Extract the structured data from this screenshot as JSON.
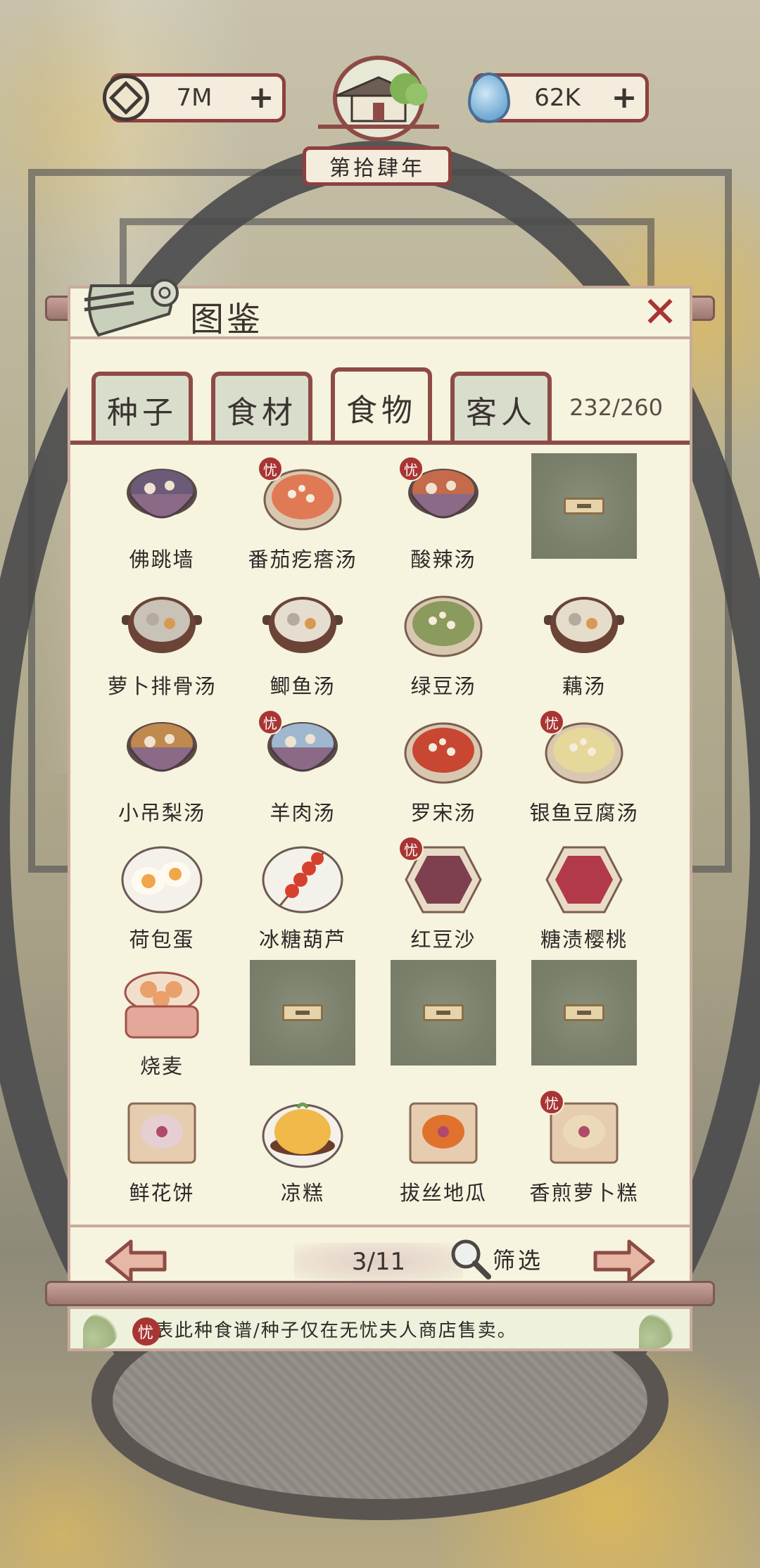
{
  "resources": {
    "coins": {
      "value": "7M",
      "icon": "coin-icon"
    },
    "water": {
      "value": "62K",
      "icon": "water-drop-icon"
    }
  },
  "year": "第拾肆年",
  "panel": {
    "title": "图鉴",
    "close_label": "✕",
    "tabs": [
      {
        "label": "种子",
        "active": false
      },
      {
        "label": "食材",
        "active": false
      },
      {
        "label": "食物",
        "active": true
      },
      {
        "label": "客人",
        "active": false
      }
    ],
    "count": "232/260"
  },
  "items": [
    {
      "name": "佛跳墙",
      "shop_only": false,
      "locked": false,
      "kind": "bowl",
      "color": "#6b5a78"
    },
    {
      "name": "番茄疙瘩汤",
      "shop_only": true,
      "locked": false,
      "kind": "plate",
      "color": "#e07a55"
    },
    {
      "name": "酸辣汤",
      "shop_only": true,
      "locked": false,
      "kind": "bowl",
      "color": "#c56a4a"
    },
    {
      "name": "",
      "shop_only": false,
      "locked": true
    },
    {
      "name": "萝卜排骨汤",
      "shop_only": false,
      "locked": false,
      "kind": "pot",
      "color": "#c9c2b6"
    },
    {
      "name": "鲫鱼汤",
      "shop_only": false,
      "locked": false,
      "kind": "pot",
      "color": "#e4ddd0"
    },
    {
      "name": "绿豆汤",
      "shop_only": false,
      "locked": false,
      "kind": "plate",
      "color": "#8b9a5d"
    },
    {
      "name": "藕汤",
      "shop_only": false,
      "locked": false,
      "kind": "pot",
      "color": "#e6dccb"
    },
    {
      "name": "小吊梨汤",
      "shop_only": false,
      "locked": false,
      "kind": "bowl",
      "color": "#c08a4e"
    },
    {
      "name": "羊肉汤",
      "shop_only": true,
      "locked": false,
      "kind": "bowl",
      "color": "#9fb8d0"
    },
    {
      "name": "罗宋汤",
      "shop_only": false,
      "locked": false,
      "kind": "plate",
      "color": "#c84732"
    },
    {
      "name": "银鱼豆腐汤",
      "shop_only": true,
      "locked": false,
      "kind": "plate",
      "color": "#e6d79a"
    },
    {
      "name": "荷包蛋",
      "shop_only": false,
      "locked": false,
      "kind": "eggs",
      "color": "#f0a64a"
    },
    {
      "name": "冰糖葫芦",
      "shop_only": false,
      "locked": false,
      "kind": "skewer",
      "color": "#d6412e"
    },
    {
      "name": "红豆沙",
      "shop_only": true,
      "locked": false,
      "kind": "hex",
      "color": "#7e3f4f"
    },
    {
      "name": "糖渍樱桃",
      "shop_only": false,
      "locked": false,
      "kind": "hex",
      "color": "#b23a48"
    },
    {
      "name": "烧麦",
      "shop_only": false,
      "locked": false,
      "kind": "steamer",
      "color": "#e9a06a"
    },
    {
      "name": "",
      "shop_only": false,
      "locked": true
    },
    {
      "name": "",
      "shop_only": false,
      "locked": true
    },
    {
      "name": "",
      "shop_only": false,
      "locked": true
    },
    {
      "name": "鲜花饼",
      "shop_only": false,
      "locked": false,
      "kind": "board",
      "color": "#e6cfd2"
    },
    {
      "name": "凉糕",
      "shop_only": false,
      "locked": false,
      "kind": "cake",
      "color": "#f0b94a"
    },
    {
      "name": "拔丝地瓜",
      "shop_only": false,
      "locked": false,
      "kind": "board",
      "color": "#e0722e"
    },
    {
      "name": "香煎萝卜糕",
      "shop_only": true,
      "locked": false,
      "kind": "board",
      "color": "#ecd9b8"
    }
  ],
  "pager": {
    "text": "3/11",
    "filter_label": "筛选"
  },
  "notice": {
    "badge": "忧",
    "text": "代表此种食谱/种子仅在无忧夫人商店售卖。"
  },
  "badge_text": "忧",
  "colors": {
    "accent_red": "#a83533",
    "frame_brown": "#8e4b45",
    "panel_bg": "#f6f3df"
  }
}
